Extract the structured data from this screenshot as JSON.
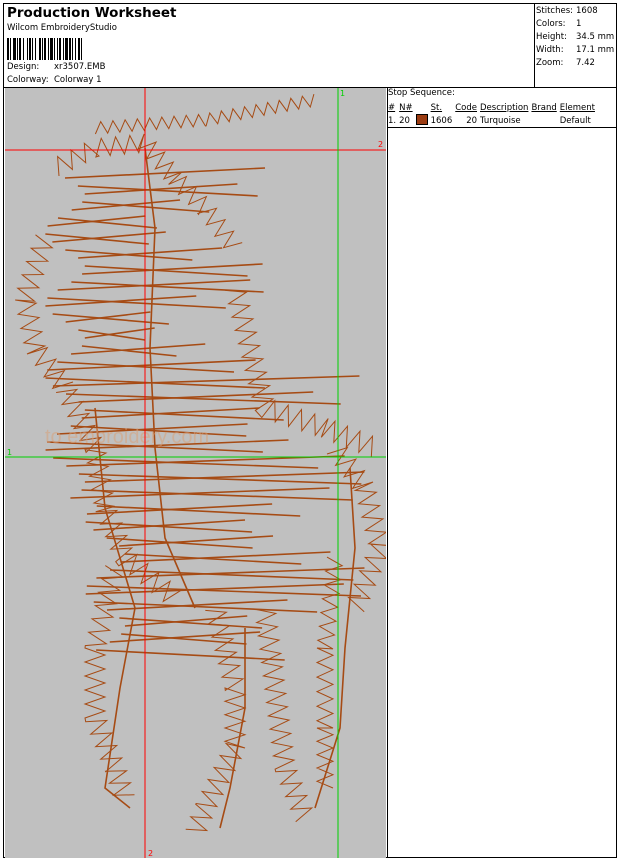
{
  "header": {
    "title": "Production Worksheet",
    "software": "Wilcom EmbroideryStudio",
    "design_label": "Design:",
    "design_value": "xr3507.EMB",
    "colorway_label": "Colorway:",
    "colorway_value": "Colorway 1"
  },
  "stats": [
    {
      "label": "Stitches:",
      "value": "1608"
    },
    {
      "label": "Colors:",
      "value": "1"
    },
    {
      "label": "Height:",
      "value": "34.5 mm"
    },
    {
      "label": "Width:",
      "value": "17.1 mm"
    },
    {
      "label": "Zoom:",
      "value": "7.42"
    }
  ],
  "stop_sequence": {
    "title": "Stop Sequence:",
    "columns": [
      "#",
      "N#",
      "St.",
      "Code",
      "Description",
      "Brand",
      "Element"
    ],
    "rows": [
      {
        "index": "1.",
        "needle": "20",
        "color": "#9b3c12",
        "stitches": "1606",
        "code": "20",
        "description": "Turquoise",
        "brand": "",
        "element": "Default"
      }
    ]
  },
  "canvas": {
    "background": "#c0c0c0",
    "thread_color": "#a64b14",
    "red_guide": "#ff0000",
    "green_guide": "#00d000",
    "guide_labels": {
      "red_v_bottom": "2",
      "red_h_right": "2",
      "green_v_top": "1",
      "green_h_left": "1"
    },
    "watermark": "to embroidery.com"
  }
}
